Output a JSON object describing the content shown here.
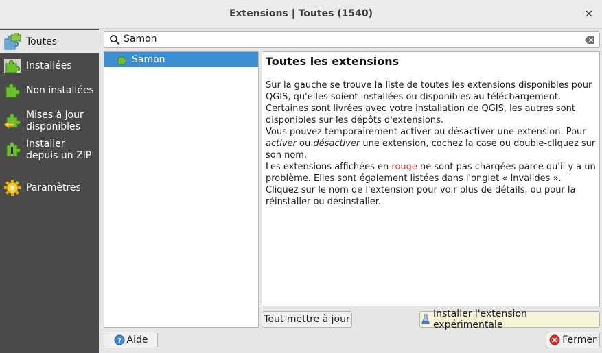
{
  "window": {
    "title": "Extensions | Toutes (1540)",
    "close_glyph": "×"
  },
  "sidebar": {
    "items": [
      {
        "label": "Toutes",
        "icon": "puzzle-all-icon",
        "active": true
      },
      {
        "label": "Installées",
        "icon": "puzzle-installed-icon"
      },
      {
        "label": "Non installées",
        "icon": "puzzle-not-installed-icon"
      },
      {
        "label": "Mises à jour disponibles",
        "icon": "puzzle-upgrade-icon"
      },
      {
        "label": "Installer depuis un ZIP",
        "icon": "puzzle-zip-icon"
      },
      {
        "label": "Paramètres",
        "icon": "settings-gear-icon"
      }
    ]
  },
  "search": {
    "value": "Samon"
  },
  "plugin_list": {
    "items": [
      {
        "name": "Samon",
        "selected": true
      }
    ]
  },
  "description": {
    "title": "Toutes les extensions",
    "para1": "Sur la gauche se trouve la liste de toutes les extensions disponibles pour QGIS, qu'elles soient installées ou disponibles au téléchargement. Certaines sont livrées avec votre installation de QGIS, les autres sont disponibles sur les dépôts d'extensions.",
    "para2_a": "Vous pouvez temporairement activer ou désactiver une extension. Pour ",
    "para2_em1": "activer",
    "para2_b": " ou ",
    "para2_em2": "désactiver",
    "para2_c": " une extension, cochez la case ou double-cliquez sur son nom.",
    "para3_a": "Les extensions affichées en ",
    "para3_red": "rouge",
    "para3_b": " ne sont pas chargées parce qu'il y a un problème. Elles sont également listées dans l'onglet « Invalides ». Cliquez sur le nom de l'extension pour voir plus de détails, ou pour la réinstaller ou désinstaller."
  },
  "buttons": {
    "upgrade_all": "Tout mettre à jour",
    "install_experimental": "Installer l'extension expérimentale",
    "help": "Aide",
    "close": "Fermer"
  },
  "colors": {
    "sidebar_bg": "#4a4a4a",
    "selection": "#3d8fd1",
    "invalid_red": "#e23b3b",
    "puzzle_green": "#6cbf2f"
  }
}
